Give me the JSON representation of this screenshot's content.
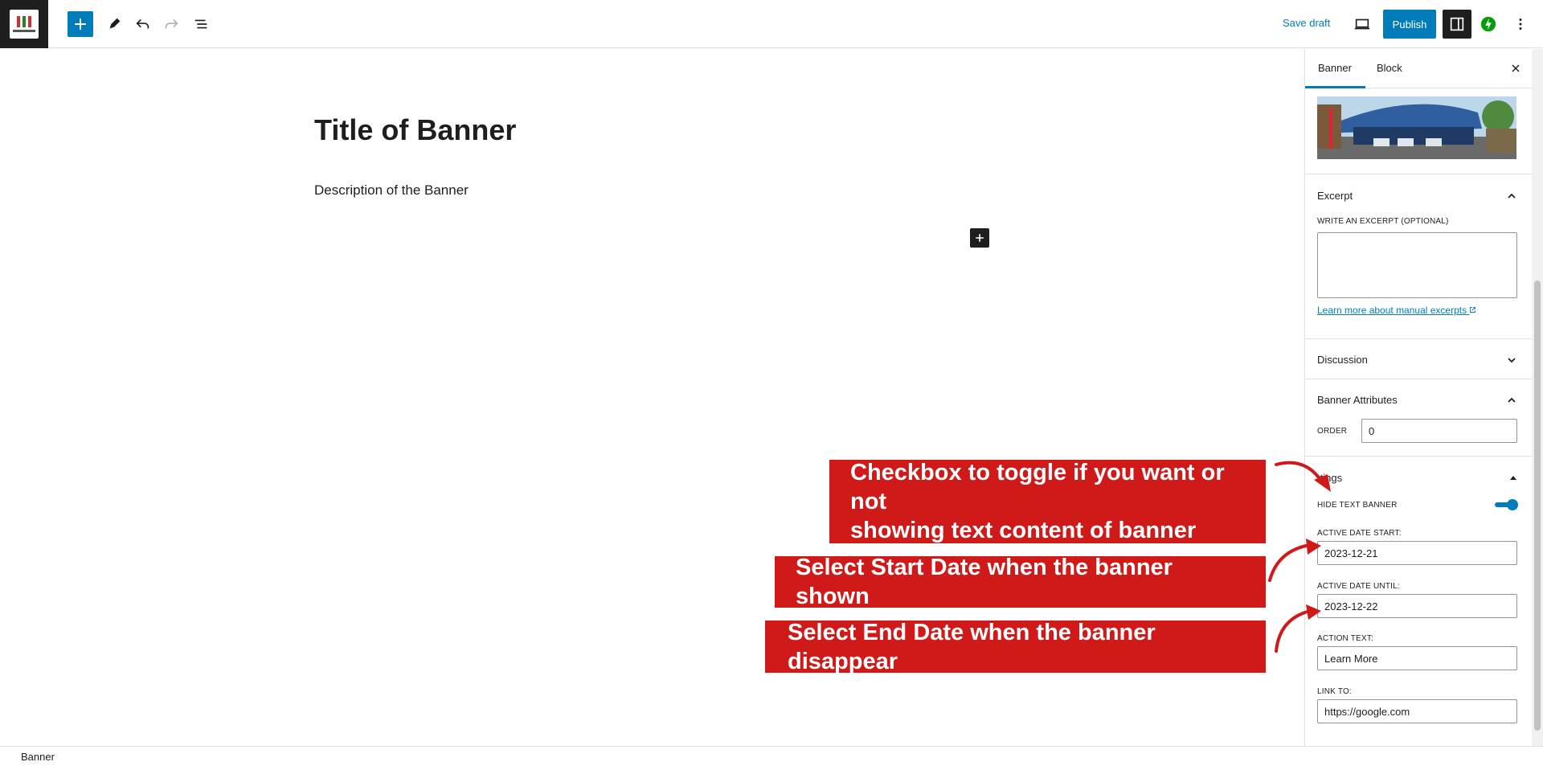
{
  "toolbar": {
    "save_draft": "Save draft",
    "publish": "Publish"
  },
  "editor": {
    "title": "Title of Banner",
    "description": "Description of the Banner"
  },
  "sidebar": {
    "tabs": [
      "Banner",
      "Block"
    ],
    "active_tab": "Banner",
    "excerpt": {
      "heading": "Excerpt",
      "label": "WRITE AN EXCERPT (OPTIONAL)",
      "value": "",
      "link": "Learn more about manual excerpts"
    },
    "discussion": {
      "heading": "Discussion"
    },
    "banner_attributes": {
      "heading": "Banner Attributes",
      "order_label": "ORDER",
      "order_value": "0"
    },
    "settings": {
      "heading_partial": "ttings",
      "hide_text_label": "HIDE TEXT BANNER",
      "hide_text_on": true,
      "date_start_label": "ACTIVE DATE START:",
      "date_start_value": "2023-12-21",
      "date_until_label": "ACTIVE DATE UNTIL:",
      "date_until_value": "2023-12-22",
      "action_text_label": "ACTION TEXT:",
      "action_text_value": "Learn More",
      "link_to_label": "LINK TO:",
      "link_to_value": "https://google.com"
    }
  },
  "annotations": {
    "toggle_note_line1": "Checkbox to toggle if you want or not",
    "toggle_note_line2": "showing text content of banner",
    "start_note": "Select Start Date when the banner shown",
    "end_note": "Select End Date when the banner disappear"
  },
  "footer": {
    "breadcrumb": "Banner"
  },
  "colors": {
    "accent": "#007cba",
    "annotation": "#d01919",
    "dark": "#1e1e1e"
  },
  "icons": [
    "plus-icon",
    "pencil-icon",
    "undo-icon",
    "redo-icon",
    "list-view-icon",
    "desktop-preview-icon",
    "sidebar-settings-icon",
    "jetpack-icon",
    "more-vertical-icon",
    "close-icon",
    "chevron-up-icon",
    "chevron-down-icon",
    "caret-up-icon",
    "external-link-icon"
  ]
}
